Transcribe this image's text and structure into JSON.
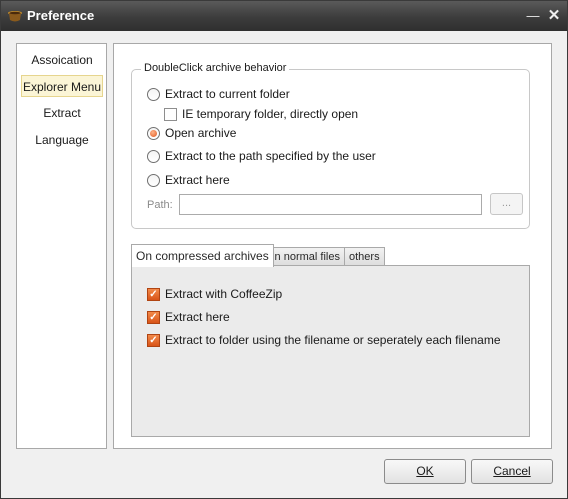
{
  "window": {
    "title": "Preference"
  },
  "sidebar": {
    "items": [
      {
        "label": "Assoication"
      },
      {
        "label": "Explorer Menu",
        "active": true
      },
      {
        "label": "Extract"
      },
      {
        "label": "Language"
      }
    ]
  },
  "doubleclick": {
    "legend": "DoubleClick archive behavior",
    "options": [
      {
        "label": "Extract to current folder",
        "selected": false
      },
      {
        "label": "Open archive",
        "selected": true
      },
      {
        "label": "Extract to the path specified by the user",
        "selected": false
      },
      {
        "label": "Extract here",
        "selected": false
      }
    ],
    "ie_temp_option": {
      "label": "IE temporary folder, directly open",
      "checked": false
    },
    "path_label": "Path:",
    "path_value": "",
    "browse_label": "..."
  },
  "tabs": [
    {
      "label": "On compressed archives",
      "active": true
    },
    {
      "label": "On normal files",
      "active": false
    },
    {
      "label": "others",
      "active": false
    }
  ],
  "menu_options": [
    {
      "label": "Extract with CoffeeZip",
      "checked": true
    },
    {
      "label": "Extract here",
      "checked": true
    },
    {
      "label": "Extract to folder using the filename or seperately each filename",
      "checked": true
    }
  ],
  "footer": {
    "ok_label": "OK",
    "cancel_label": "Cancel"
  },
  "colors": {
    "accent": "#e0571d",
    "selection": "#fbf5d6",
    "titlebar": "#3c3c3c"
  }
}
